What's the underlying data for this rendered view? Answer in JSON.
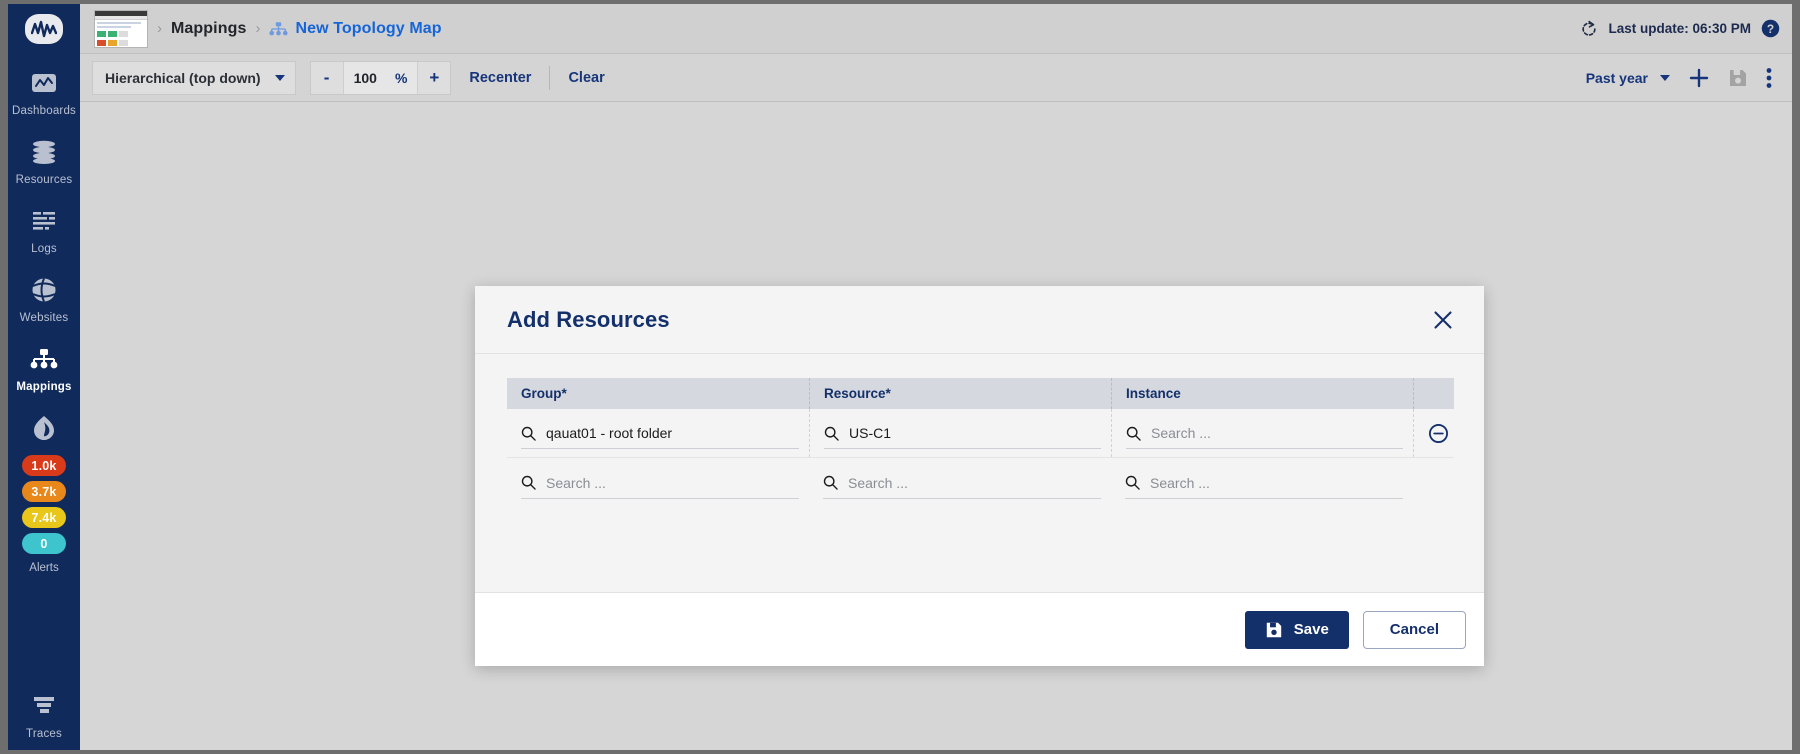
{
  "sidebar": {
    "logo_name": "logicmonitor-logo",
    "items": [
      {
        "label": "Dashboards",
        "icon": "dashboards-icon",
        "active": false
      },
      {
        "label": "Resources",
        "icon": "resources-icon",
        "active": false
      },
      {
        "label": "Logs",
        "icon": "logs-icon",
        "active": false
      },
      {
        "label": "Websites",
        "icon": "websites-icon",
        "active": false
      },
      {
        "label": "Mappings",
        "icon": "mappings-icon",
        "active": true
      }
    ],
    "alerts": {
      "label": "Alerts",
      "icon": "alert-flame-icon",
      "badges": [
        {
          "value": "1.0k",
          "color": "#d93b1a",
          "severity": "critical"
        },
        {
          "value": "3.7k",
          "color": "#e8871a",
          "severity": "error"
        },
        {
          "value": "7.4k",
          "color": "#e8c61a",
          "severity": "warning"
        },
        {
          "value": "0",
          "color": "#3dc4cd",
          "severity": "info"
        }
      ]
    },
    "traces": {
      "label": "Traces",
      "icon": "traces-icon"
    }
  },
  "topbar": {
    "thumbnail_name": "page-thumbnail",
    "breadcrumb": [
      {
        "label": "Mappings",
        "type": "text"
      },
      {
        "label": "New Topology Map",
        "type": "link",
        "icon": "topology-icon"
      }
    ],
    "separator": "›",
    "refresh_icon": "refresh-icon",
    "last_update": "Last update: 06:30 PM",
    "help_icon": "help-icon"
  },
  "toolbar": {
    "layout_select": "Hierarchical (top down)",
    "zoom_minus": "-",
    "zoom_value": "100",
    "zoom_unit": "%",
    "zoom_plus": "+",
    "recenter": "Recenter",
    "clear": "Clear",
    "time_range": "Past year",
    "add_icon": "plus-icon",
    "save_icon": "save-disk-icon",
    "more_icon": "more-vertical-icon"
  },
  "modal": {
    "title": "Add Resources",
    "close_icon": "close-icon",
    "columns": [
      {
        "label": "Group*"
      },
      {
        "label": "Resource*"
      },
      {
        "label": "Instance"
      },
      {
        "label": ""
      }
    ],
    "search_placeholder": "Search ...",
    "search_icon": "search-icon",
    "remove_icon": "remove-circle-icon",
    "rows": [
      {
        "group": "qauat01 - root folder",
        "resource": "US-C1",
        "instance": "",
        "instance_placeholder": "Search ...",
        "removable": true
      },
      {
        "group": "",
        "group_placeholder": "Search ...",
        "resource": "",
        "resource_placeholder": "Search ...",
        "instance": "",
        "instance_placeholder": "Search ...",
        "removable": false
      }
    ],
    "save_label": "Save",
    "save_icon": "save-disk-icon",
    "cancel_label": "Cancel"
  },
  "colors": {
    "brand_navy": "#14306b",
    "sidebar_bg": "#102a5c",
    "link_blue": "#1565d8"
  }
}
